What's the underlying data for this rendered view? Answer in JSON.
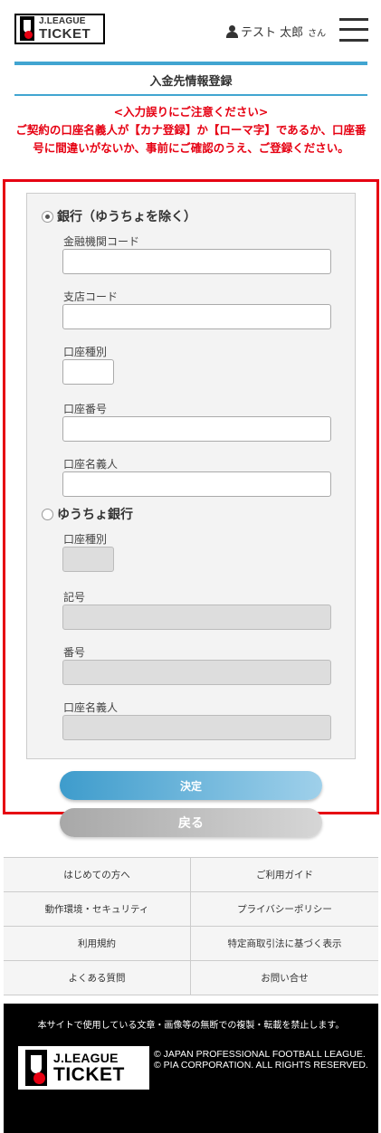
{
  "header": {
    "logo_top": "J.LEAGUE",
    "logo_bottom": "TICKET",
    "user_name": "テスト 太郎",
    "user_suffix": "さん"
  },
  "page": {
    "title": "入金先情報登録",
    "notice_line1": "<入力誤りにご注意ください>",
    "notice_line2": "ご契約の口座名義人が【カナ登録】か【ローマ字】であるか、口座番号に間違いがないか、事前にご確認のうえ、ご登録ください。"
  },
  "form": {
    "bank": {
      "label": "銀行（ゆうちょを除く）",
      "selected": true,
      "institution_code_label": "金融機関コード",
      "branch_code_label": "支店コード",
      "account_type_label": "口座種別",
      "account_number_label": "口座番号",
      "account_holder_label": "口座名義人"
    },
    "yucho": {
      "label": "ゆうちょ銀行",
      "selected": false,
      "account_type_label": "口座種別",
      "symbol_label": "記号",
      "number_label": "番号",
      "account_holder_label": "口座名義人"
    }
  },
  "buttons": {
    "submit": "決定",
    "back": "戻る"
  },
  "footer": {
    "links": [
      [
        "はじめての方へ",
        "ご利用ガイド"
      ],
      [
        "動作環境・セキュリティ",
        "プライバシーポリシー"
      ],
      [
        "利用規約",
        "特定商取引法に基づく表示"
      ],
      [
        "よくある質問",
        "お問い合せ"
      ]
    ],
    "copyright_note": "本サイトで使用している文章・画像等の無断での複製・転載を禁止します。",
    "copyright_1": "© JAPAN PROFESSIONAL FOOTBALL LEAGUE.",
    "copyright_2": "© PIA CORPORATION. ALL RIGHTS RESERVED."
  },
  "colors": {
    "accent": "#41a5d1",
    "alert": "#e60012"
  }
}
